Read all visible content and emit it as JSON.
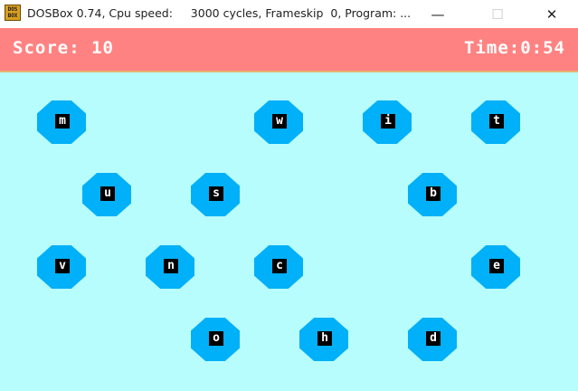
{
  "window": {
    "title": "DOSBox 0.74, Cpu speed:     3000 cycles, Frameskip  0, Program: ...",
    "app_icon_label": "DOS BOX",
    "minimize": "—",
    "maximize": "☐",
    "close": "✕"
  },
  "game": {
    "score_text": "Score: 10",
    "time_text": "Time:0:54",
    "colors": {
      "background": "#b8fdfd",
      "status_bar": "#ff8282",
      "bubble": "#00b0f8",
      "tile": "#000000"
    },
    "bubbles": [
      {
        "letter": "m"
      },
      {
        "letter": "w"
      },
      {
        "letter": "i"
      },
      {
        "letter": "t"
      },
      {
        "letter": "u"
      },
      {
        "letter": "s"
      },
      {
        "letter": "b"
      },
      {
        "letter": "v"
      },
      {
        "letter": "n"
      },
      {
        "letter": "c"
      },
      {
        "letter": "e"
      },
      {
        "letter": "o"
      },
      {
        "letter": "h"
      },
      {
        "letter": "d"
      }
    ]
  }
}
